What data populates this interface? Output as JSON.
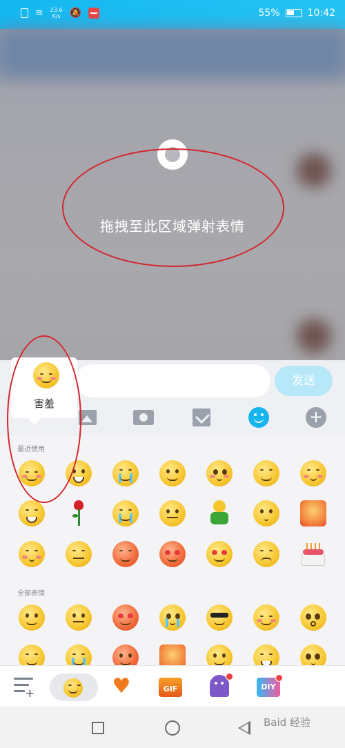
{
  "status_bar": {
    "speed_value": "23.6",
    "speed_unit": "K/s",
    "battery": "55%",
    "time": "10:42",
    "battery_level": 0.55
  },
  "drop_zone": {
    "text": "拖拽至此区域弹射表情"
  },
  "input_bar": {
    "send_label": "发送"
  },
  "popup": {
    "label": "害羞"
  },
  "panel": {
    "recent_label": "最近使用",
    "all_label": "全部表情",
    "recent_items": [
      "shy-emoji",
      "laugh-emoji",
      "cry-emoji",
      "smile-emoji",
      "scared-emoji",
      "snicker-emoji",
      "embarrassed-emoji",
      "laugh-tears-emoji",
      "rose-icon",
      "sob-emoji",
      "puzzled-emoji",
      "green-man-emoji",
      "dizzy-emoji",
      "angry-emoji",
      "awkward-emoji",
      "sweat-emoji",
      "wronged-emoji",
      "heart-eyes-emoji",
      "heart-eyes-emoji",
      "sad-emoji",
      "cake-icon"
    ],
    "all_items": [
      "smile-emoji",
      "puzzled-emoji",
      "heart-eyes-emoji",
      "scared-emoji",
      "cool-emoji",
      "shy-emoji",
      "shocked-emoji",
      "sleepy-emoji",
      "sob-emoji",
      "angry-emoji",
      "furious-emoji",
      "tongue-emoji",
      "grin-emoji",
      "dazed-emoji"
    ]
  },
  "category_bar": {
    "gif_label": "GIF",
    "diy_label": "DIY"
  },
  "watermark": {
    "text": "Baid 经验"
  },
  "colors": {
    "accent": "#16b5ee",
    "annotation_red": "#d3262c",
    "badge_red": "#f04141"
  }
}
